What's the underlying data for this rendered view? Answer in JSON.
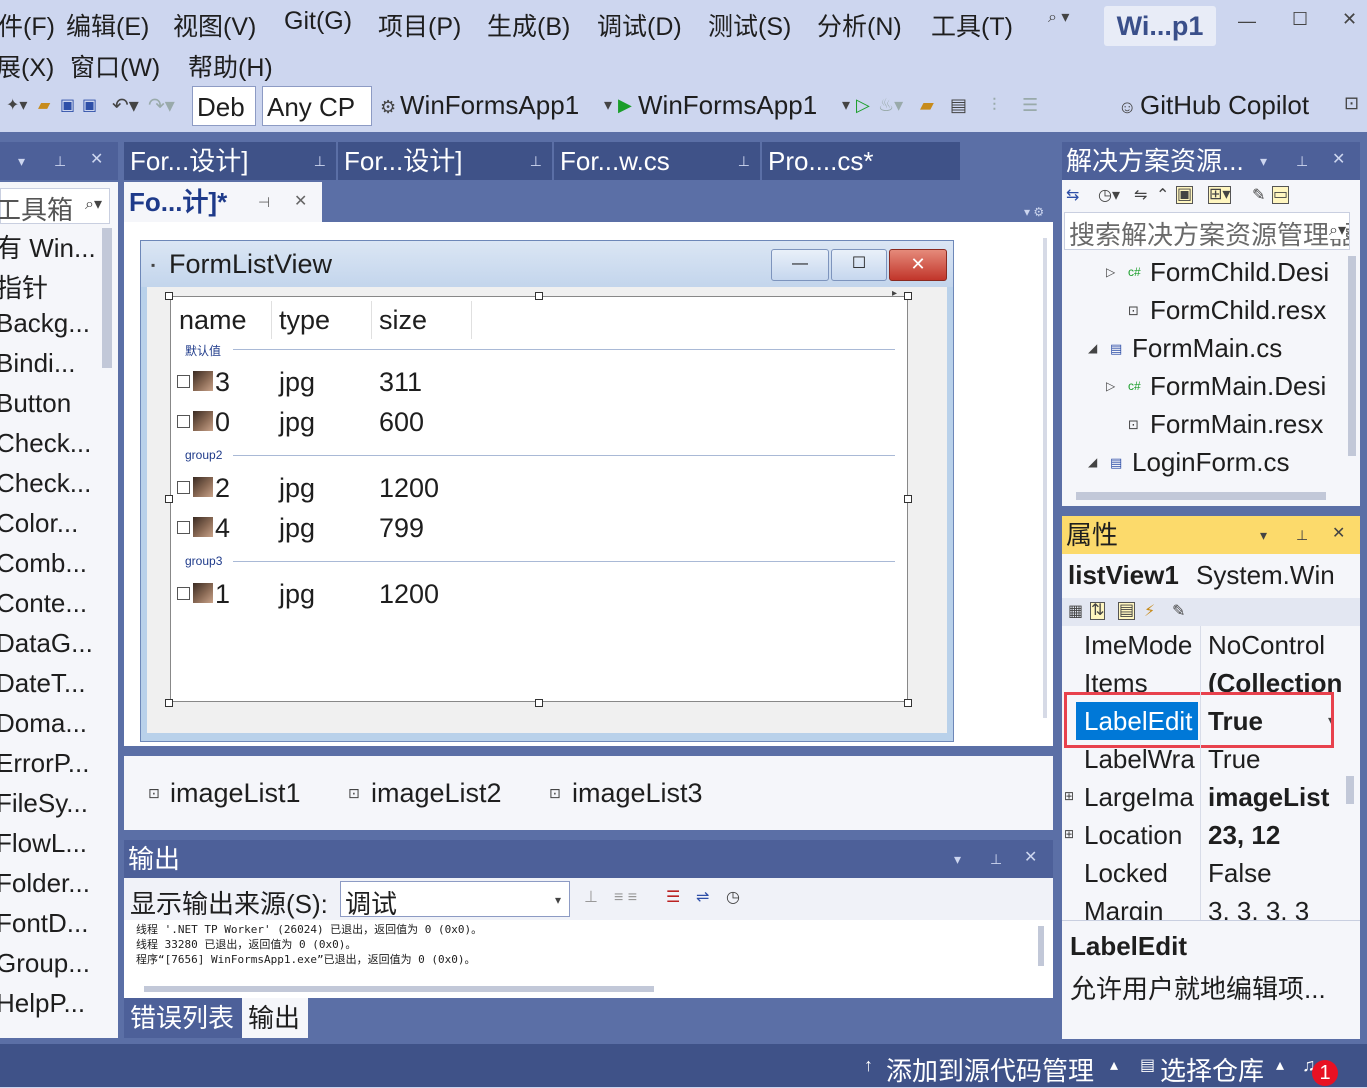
{
  "menu": {
    "items": [
      "件(F)",
      "编辑(E)",
      "视图(V)",
      "Git(G)",
      "项目(P)",
      "生成(B)",
      "调试(D)",
      "测试(S)",
      "分析(N)",
      "工具(T)",
      "展(X)",
      "窗口(W)",
      "帮助(H)"
    ],
    "solution_badge": "Wi...p1"
  },
  "toolbar": {
    "config": "Deb",
    "platform": "Any CP",
    "project": "WinFormsApp1",
    "start": "WinFormsApp1",
    "copilot": "GitHub Copilot"
  },
  "toolbox": {
    "title": "工具箱",
    "items": [
      "有 Win...",
      "指针",
      "Backg...",
      "Bindi...",
      "Button",
      "Check...",
      "Check...",
      "Color...",
      "Comb...",
      "Conte...",
      "DataG...",
      "DateT...",
      "Doma...",
      "ErrorP...",
      "FileSy...",
      "FlowL...",
      "Folder...",
      "FontD...",
      "Group...",
      "HelpP..."
    ]
  },
  "doc_tabs": {
    "row1": [
      "For...设计]",
      "For...设计]",
      "For...w.cs",
      "Pro....cs*"
    ],
    "active": "Fo...计]*"
  },
  "form": {
    "title": "FormListView",
    "columns": [
      "name",
      "type",
      "size"
    ],
    "groups": [
      {
        "label": "默认值",
        "rows": [
          [
            "3",
            "jpg",
            "311"
          ],
          [
            "0",
            "jpg",
            "600"
          ]
        ]
      },
      {
        "label": "group2",
        "rows": [
          [
            "2",
            "jpg",
            "1200"
          ],
          [
            "4",
            "jpg",
            "799"
          ]
        ]
      },
      {
        "label": "group3",
        "rows": [
          [
            "1",
            "jpg",
            "1200"
          ]
        ]
      }
    ]
  },
  "tray": {
    "items": [
      "imageList1",
      "imageList2",
      "imageList3"
    ]
  },
  "output": {
    "title": "输出",
    "source_label": "显示输出来源(S):",
    "source_value": "调试",
    "lines": [
      "线程 '.NET TP Worker' (26024) 已退出，返回值为 0 (0x0)。",
      "线程 33280 已退出，返回值为 0 (0x0)。",
      "程序“[7656] WinFormsApp1.exe”已退出，返回值为 0 (0x0)。"
    ],
    "tabs": [
      "错误列表",
      "输出"
    ]
  },
  "solution_explorer": {
    "title": "解决方案资源...",
    "search_placeholder": "搜索解决方案资源管理器",
    "nodes": [
      {
        "label": "FormChild.Desi"
      },
      {
        "label": "FormChild.resx"
      },
      {
        "label": "FormMain.cs"
      },
      {
        "label": "FormMain.Desi"
      },
      {
        "label": "FormMain.resx"
      },
      {
        "label": "LoginForm.cs"
      }
    ]
  },
  "properties": {
    "title": "属性",
    "object_name": "listView1",
    "object_type": "System.Win",
    "rows": [
      {
        "name": "ImeMode",
        "value": "NoControl"
      },
      {
        "name": "Items",
        "value": "(Collection"
      },
      {
        "name": "LabelEdit",
        "value": "True"
      },
      {
        "name": "LabelWra",
        "value": "True"
      },
      {
        "name": "LargeIma",
        "value": "imageList"
      },
      {
        "name": "Location",
        "value": "23, 12"
      },
      {
        "name": "Locked",
        "value": "False"
      },
      {
        "name": "Margin",
        "value": "3, 3, 3, 3"
      }
    ],
    "desc_title": "LabelEdit",
    "desc_text": "允许用户就地编辑项..."
  },
  "statusbar": {
    "source_control": "添加到源代码管理",
    "repo": "选择仓库",
    "notifications": "1"
  },
  "colors": {
    "chrome": "#cdd6ef",
    "panel_header": "#4d6099",
    "selection": "#0078d7",
    "highlight_border": "#e8414d",
    "badge": "#e81123"
  }
}
